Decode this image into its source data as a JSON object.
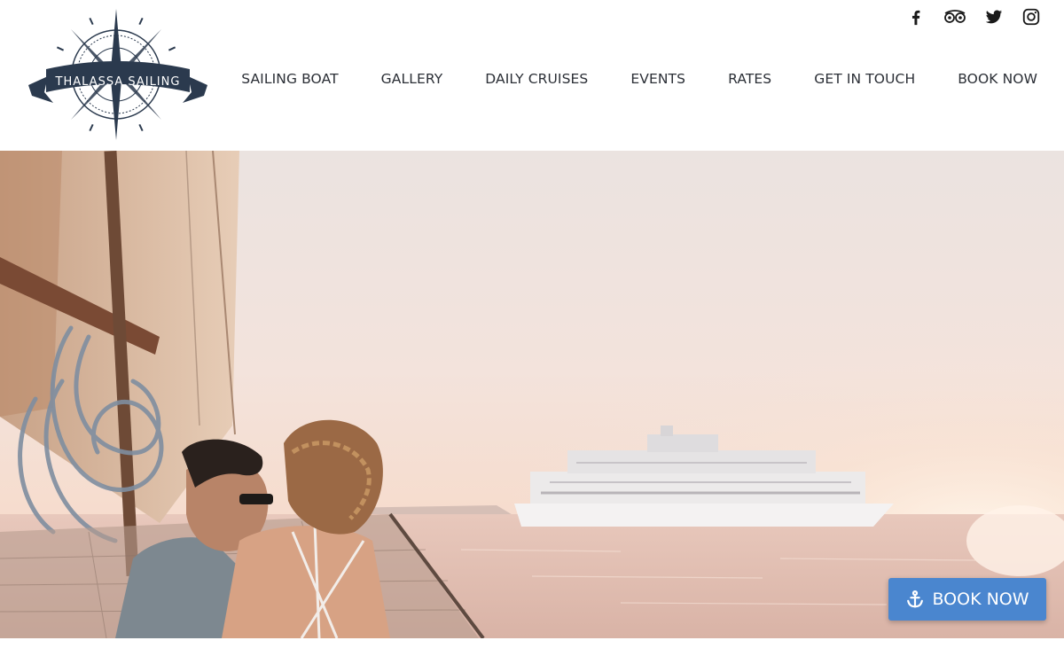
{
  "brand": {
    "logo_text": "THALASSA SAILING",
    "color": "#2b3a4e"
  },
  "social": [
    {
      "name": "facebook-icon"
    },
    {
      "name": "tripadvisor-icon"
    },
    {
      "name": "twitter-icon"
    },
    {
      "name": "instagram-icon"
    }
  ],
  "nav": {
    "items": [
      {
        "label": "SAILING BOAT"
      },
      {
        "label": "GALLERY"
      },
      {
        "label": "DAILY CRUISES"
      },
      {
        "label": "EVENTS"
      },
      {
        "label": "RATES"
      },
      {
        "label": "GET IN TOUCH"
      },
      {
        "label": "BOOK NOW"
      }
    ]
  },
  "cta": {
    "label": "BOOK NOW",
    "icon": "anchor-icon",
    "color": "#4a86cf"
  }
}
